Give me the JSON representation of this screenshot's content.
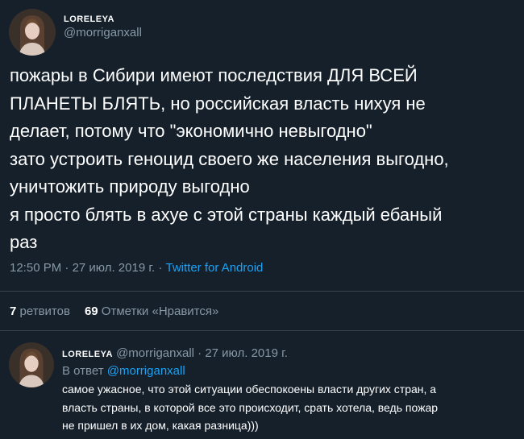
{
  "tweet": {
    "author": {
      "display_name": "LORELEYA",
      "handle": "@morriganxall"
    },
    "lines": [
      "пожары в Сибири имеют последствия ДЛЯ ВСЕЙ",
      "ПЛАНЕТЫ БЛЯТЬ, но российская власть нихуя не",
      "делает, потому что \"экономично невыгодно\"",
      "зато устроить геноцид своего же населения выгодно,",
      "уничтожить природу выгодно",
      "я просто блять в ахуе с этой страны каждый ебаный",
      "раз"
    ],
    "time": "12:50 PM",
    "date": "27 июл. 2019 г.",
    "separator": "·",
    "source": "Twitter for Android"
  },
  "stats": {
    "retweets_count": "7",
    "retweets_label": "ретвитов",
    "likes_count": "69",
    "likes_label": "Отметки «Нравится»"
  },
  "reply": {
    "display_name": "LORELEYA",
    "handle": "@morriganxall",
    "separator": "·",
    "date": "27 июл. 2019 г.",
    "reply_to_label": "В ответ",
    "reply_to_handle": "@morriganxall",
    "lines": [
      "самое ужасное, что этой ситуации обеспокоены власти других стран, а",
      "власть страны, в которой все это происходит, срать хотела, ведь пожар",
      "не пришел в их дом, какая разница)))"
    ]
  },
  "colors": {
    "background": "#15202b",
    "text_primary": "#ffffff",
    "text_secondary": "#8899a6",
    "link": "#1da1f2",
    "divider": "#38444d"
  }
}
